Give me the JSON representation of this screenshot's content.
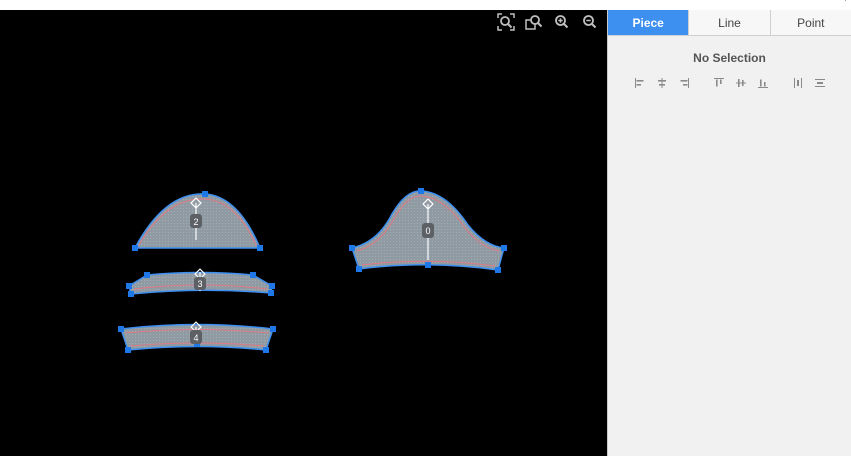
{
  "window": {
    "corner_mark": "·"
  },
  "toolbar": {
    "tools": [
      {
        "name": "zoom-fit-icon"
      },
      {
        "name": "zoom-selection-icon"
      },
      {
        "name": "zoom-in-icon"
      },
      {
        "name": "zoom-out-icon"
      }
    ]
  },
  "pieces": [
    {
      "id": "piece-2",
      "label": "2"
    },
    {
      "id": "piece-3",
      "label": "3"
    },
    {
      "id": "piece-4",
      "label": "4"
    },
    {
      "id": "piece-0",
      "label": "0"
    }
  ],
  "panel": {
    "tabs": [
      {
        "label": "Piece",
        "active": true
      },
      {
        "label": "Line",
        "active": false
      },
      {
        "label": "Point",
        "active": false
      }
    ],
    "selection_text": "No Selection",
    "align_tools": [
      "align-left-icon",
      "align-center-horizontal-icon",
      "align-right-icon",
      "align-top-icon",
      "align-center-vertical-icon",
      "align-bottom-icon",
      "distribute-horizontal-icon",
      "distribute-vertical-icon"
    ]
  },
  "colors": {
    "canvas_bg": "#000000",
    "piece_fill": "#8f9aa3",
    "piece_outline": "#3d8ff0",
    "seam_line": "#e07a86",
    "handle": "#1f78e8",
    "label_bg": "#5d6166",
    "active_tab": "#3d8ff0"
  }
}
